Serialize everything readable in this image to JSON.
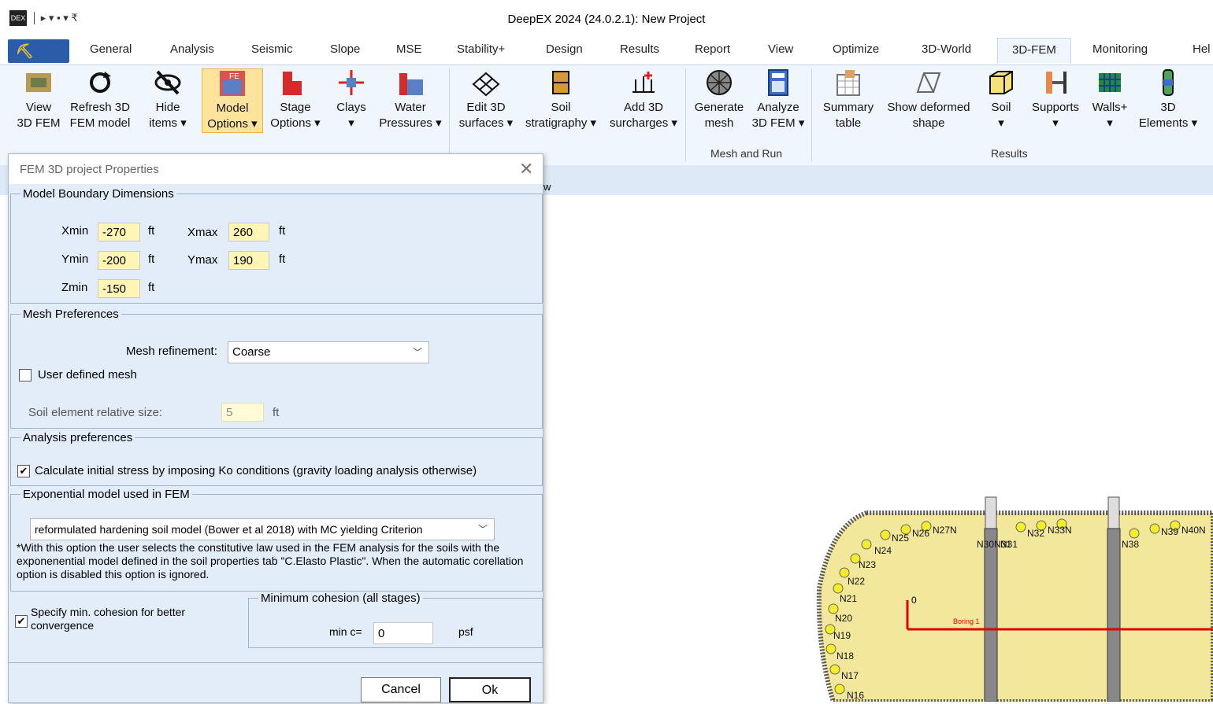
{
  "window": {
    "title": "DeepEX 2024  (24.0.2.1): New Project",
    "qat_glyphs": "│ ▸ ▾ ▪ ▾ ₹"
  },
  "tabs": [
    "General",
    "Analysis",
    "Seismic",
    "Slope",
    "MSE",
    "Stability+",
    "Design",
    "Results",
    "Report",
    "View",
    "Optimize",
    "3D-World",
    "3D-FEM",
    "Monitoring",
    "Hel"
  ],
  "active_tab": "3D-FEM",
  "ribbon": {
    "buttons": [
      {
        "l1": "View",
        "l2": "3D FEM"
      },
      {
        "l1": "Refresh 3D",
        "l2": "FEM model"
      },
      {
        "l1": "Hide",
        "l2": "items ▾"
      },
      {
        "l1": "Model",
        "l2": "Options ▾"
      },
      {
        "l1": "Stage",
        "l2": "Options ▾"
      },
      {
        "l1": "Clays",
        "l2": "▾"
      },
      {
        "l1": "Water",
        "l2": "Pressures ▾"
      },
      {
        "l1": "Edit 3D",
        "l2": "surfaces ▾"
      },
      {
        "l1": "Soil",
        "l2": "stratigraphy ▾"
      },
      {
        "l1": "Add 3D",
        "l2": "surcharges ▾"
      },
      {
        "l1": "Generate",
        "l2": "mesh"
      },
      {
        "l1": "Analyze",
        "l2": "3D FEM ▾"
      },
      {
        "l1": "Summary",
        "l2": "table"
      },
      {
        "l1": "Show deformed",
        "l2": "shape"
      },
      {
        "l1": "Soil",
        "l2": "▾"
      },
      {
        "l1": "Supports",
        "l2": "▾"
      },
      {
        "l1": "Walls+",
        "l2": "▾"
      },
      {
        "l1": "3D",
        "l2": "Elements ▾"
      }
    ],
    "groups": {
      "mesh_and_run": "Mesh and Run",
      "results": "Results"
    }
  },
  "view_strip_text": "w",
  "dialog": {
    "title": "FEM 3D project Properties",
    "close_glyph": "✕",
    "boundary": {
      "legend": "Model Boundary Dimensions",
      "xmin_label": "Xmin",
      "xmin": "-270",
      "xmax_label": "Xmax",
      "xmax": "260",
      "ymin_label": "Ymin",
      "ymin": "-200",
      "ymax_label": "Ymax",
      "ymax": "190",
      "zmin_label": "Zmin",
      "zmin": "-150",
      "unit": "ft"
    },
    "mesh": {
      "legend": "Mesh Preferences",
      "refinement_label": "Mesh refinement:",
      "refinement_value": "Coarse",
      "user_defined_label": "User defined mesh",
      "soil_size_label": "Soil element relative size:",
      "soil_size_value": "5",
      "unit": "ft"
    },
    "analysis": {
      "legend": "Analysis preferences",
      "ko_label": "Calculate initial stress by imposing Ko conditions (gravity loading analysis otherwise)",
      "ko_checked": true
    },
    "exponential": {
      "legend": "Exponential model used in FEM",
      "model_value": "reformulated hardening soil model (Bower et al 2018) with MC yielding Criterion",
      "note": "*With this option the user selects the constitutive law used  in the FEM analysis for the soils with the exponenential model defined in the soil properties tab \"C.Elasto Plastic\". When the automatic corellation option is disabled this option is ignored."
    },
    "cohesion": {
      "check_label": "Specify min. cohesion for better convergence",
      "checked": true,
      "legend": "Minimum cohesion (all stages)",
      "min_c_label": "min c=",
      "min_c_value": "0",
      "unit": "psf"
    },
    "buttons": {
      "cancel": "Cancel",
      "ok": "Ok"
    }
  },
  "model": {
    "node_labels": [
      "N25",
      "N26",
      "N27N",
      "N24",
      "N23",
      "N22",
      "N21",
      "N20",
      "N19",
      "N18",
      "N17",
      "N16",
      "N32",
      "N33N",
      "N31",
      "N38",
      "N39",
      "N40N"
    ],
    "origin_label": "0",
    "boring_label": "Boring 1",
    "overlap_label": "N30N31"
  }
}
